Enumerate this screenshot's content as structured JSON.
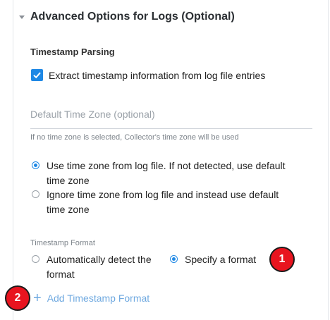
{
  "section": {
    "title": "Advanced Options for Logs (Optional)"
  },
  "timestamp_parsing": {
    "heading": "Timestamp Parsing",
    "extract_checkbox": {
      "label": "Extract timestamp information from log file entries",
      "checked": true
    }
  },
  "time_zone": {
    "placeholder": "Default Time Zone (optional)",
    "value": "",
    "helper": "If no time zone is selected, Collector's time zone will be used"
  },
  "tz_options": [
    {
      "label": "Use time zone from log file. If not detected, use default time zone",
      "selected": true
    },
    {
      "label": "Ignore time zone from log file and instead use default time zone",
      "selected": false
    }
  ],
  "timestamp_format": {
    "label": "Timestamp Format",
    "options": [
      {
        "label": "Automatically detect the format",
        "selected": false
      },
      {
        "label": "Specify a format",
        "selected": true
      }
    ],
    "add_label": "Add Timestamp Format"
  },
  "badges": [
    "1",
    "2"
  ],
  "colors": {
    "accent": "#1e88e5",
    "link": "#6fa9e0",
    "badge": "#e8141f"
  }
}
